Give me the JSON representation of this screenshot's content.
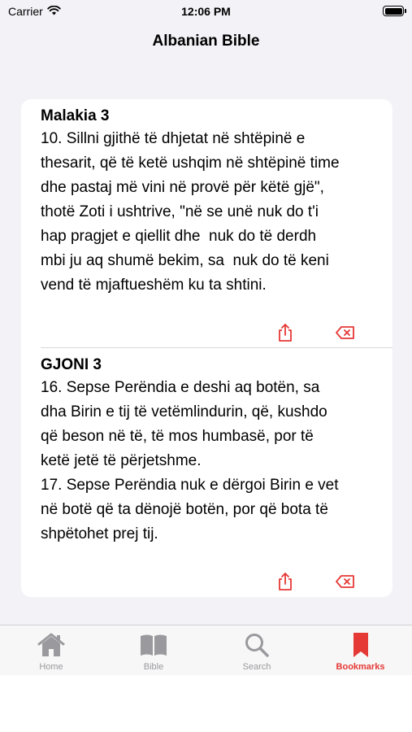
{
  "status_bar": {
    "carrier": "Carrier",
    "time": "12:06 PM"
  },
  "nav": {
    "title": "Albanian Bible"
  },
  "bookmarks": [
    {
      "title": "Malakia 3",
      "text": "10. Sillni gjithë të dhjetat në shtëpinë e\nthesarit, që të ketë ushqim në shtëpinë time\ndhe pastaj më vini në provë për këtë gjë\",\nthotë Zoti i ushtrive, \"në se unë nuk do t'i\nhap pragjet e qiellit dhe  nuk do të derdh\nmbi ju aq shumë bekim, sa  nuk do të keni\nvend të mjaftueshëm ku ta shtini.",
      "share_icon": "share-icon",
      "delete_icon": "delete-backward-icon"
    },
    {
      "title": "GJONI 3",
      "text": "16. Sepse Perëndia e deshi aq botën, sa\ndha Birin e tij të vetëmlindurin, që, kushdo\nqë beson në të, të mos humbasë, por të\nketë jetë të përjetshme.\n17. Sepse Perëndia nuk e dërgoi Birin e vet\nnë botë që ta dënojë botën, por që bota të\nshpëtohet prej tij.",
      "share_icon": "share-icon",
      "delete_icon": "delete-backward-icon"
    }
  ],
  "tabs": [
    {
      "label": "Home",
      "icon": "house-icon",
      "active": false
    },
    {
      "label": "Bible",
      "icon": "book-icon",
      "active": false
    },
    {
      "label": "Search",
      "icon": "magnifier-icon",
      "active": false
    },
    {
      "label": "Bookmarks",
      "icon": "bookmark-icon",
      "active": true
    }
  ],
  "colors": {
    "accent": "#e53935",
    "inactive": "#9a9a9e",
    "background": "#f2f2f7"
  }
}
